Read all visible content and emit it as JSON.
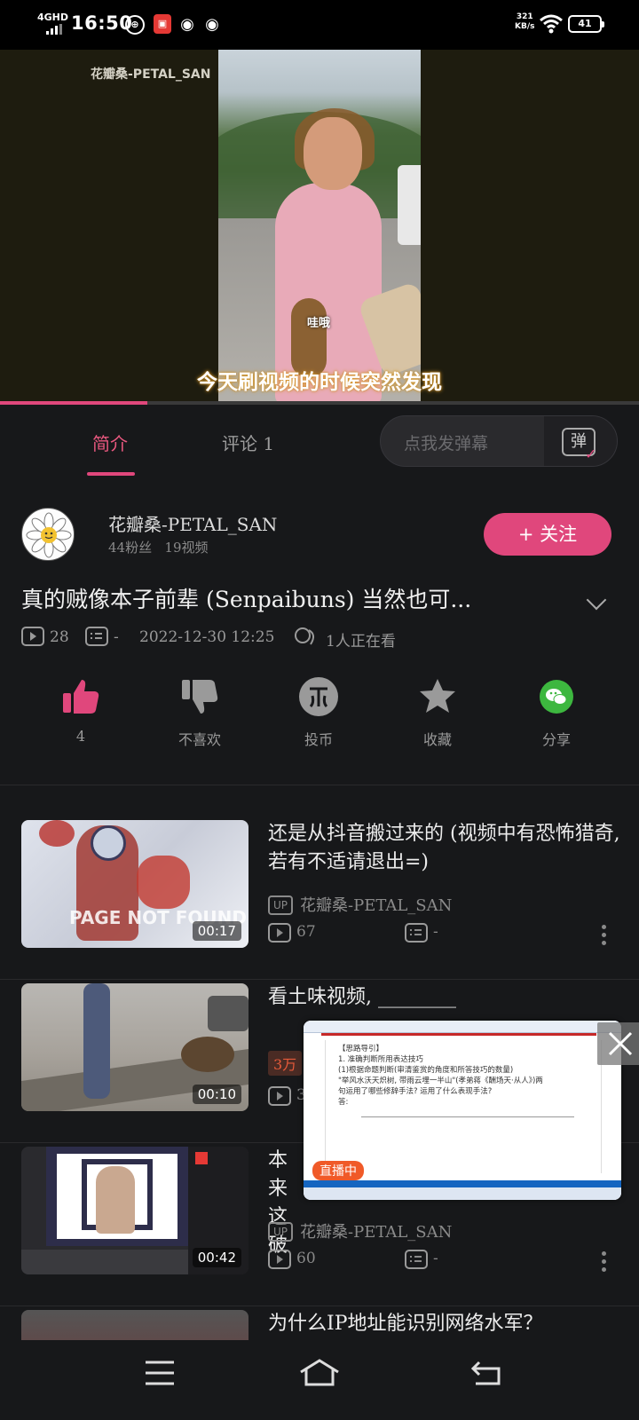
{
  "status_bar": {
    "network": "4GHD",
    "time": "16:50",
    "speed_value": "321",
    "speed_unit": "KB/s",
    "battery": "41",
    "icons": [
      "signal-bars-icon",
      "tie-badge-icon",
      "app-red-icon",
      "weibo-icon",
      "weibo-icon",
      "wifi-icon",
      "battery-icon"
    ]
  },
  "video": {
    "watermark": "花瓣桑-PETAL_SAN",
    "exclaim": "哇哦",
    "subtitle": "今天刷视频的时候突然发现",
    "progress": 0.23
  },
  "tabs": {
    "intro": "简介",
    "comment": "评论 1",
    "danmaku_placeholder": "点我发弹幕",
    "danmaku_icon_text": "弹"
  },
  "uploader": {
    "name": "花瓣桑-PETAL_SAN",
    "followers": "44粉丝",
    "videos": "19视频",
    "follow_label": "+ 关注"
  },
  "video_info": {
    "title": "真的贼像本子前辈 (Senpaibuns) 当然也可...",
    "plays": "28",
    "danmaku_count": "-",
    "date": "2022-12-30 12:25",
    "watching": "1人正在看"
  },
  "actions": [
    {
      "label": "4",
      "icon": "thumbs-up-icon",
      "color": "#e0477c"
    },
    {
      "label": "不喜欢",
      "icon": "thumbs-down-icon",
      "color": "#9a9a9a"
    },
    {
      "label": "投币",
      "icon": "coin-icon",
      "color": "#9a9a9a"
    },
    {
      "label": "收藏",
      "icon": "star-icon",
      "color": "#9a9a9a"
    },
    {
      "label": "分享",
      "icon": "wechat-icon",
      "color": "#3db73f"
    }
  ],
  "related": [
    {
      "title": "还是从抖音搬过来的 (视频中有恐怖猎奇, 若有不适请退出=)",
      "uploader": "花瓣桑-PETAL_SAN",
      "views": "67",
      "danmaku": "-",
      "duration": "00:17",
      "thumb_text": "PAGE NOT FOUND"
    },
    {
      "title": "看土味视频, ________",
      "uploader": "",
      "views": "3",
      "danmaku": "",
      "duration": "00:10",
      "badge": "3万"
    },
    {
      "title": "本来 这破",
      "uploader": "花瓣桑-PETAL_SAN",
      "views": "60",
      "danmaku": "-",
      "duration": "00:42"
    },
    {
      "title": "为什么IP地址能识别网络水军？"
    }
  ],
  "up_tag": "UP",
  "live": {
    "badge": "直播中",
    "doc_lines": [
      "【思路导引】",
      "1. 准确判断所用表达技巧",
      "(1)根据命题判断(审清鉴赏的角度和所答技巧的数量)",
      "\"举风水沃天炽树, 带雨云埋一半山\"(孝弟蒋《酬场天·从人》)两",
      "句运用了哪些修辞手法? 运用了什么表现手法?",
      "答:"
    ]
  }
}
